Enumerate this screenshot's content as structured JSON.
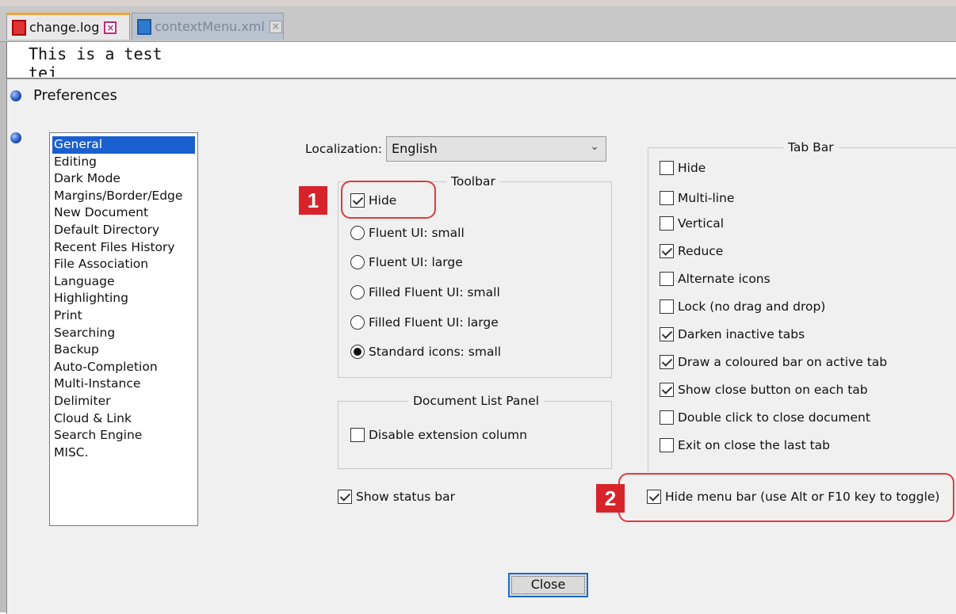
{
  "editor_tabs": [
    {
      "label": "change.log"
    },
    {
      "label": "contextMenu.xml"
    }
  ],
  "editor_lines": [
    "This is a test",
    "tej"
  ],
  "dialog": {
    "title": "Preferences",
    "close_label": "Close"
  },
  "categories": [
    "General",
    "Editing",
    "Dark Mode",
    "Margins/Border/Edge",
    "New Document",
    "Default Directory",
    "Recent Files History",
    "File Association",
    "Language",
    "Highlighting",
    "Print",
    "Searching",
    "Backup",
    "Auto-Completion",
    "Multi-Instance",
    "Delimiter",
    "Cloud & Link",
    "Search Engine",
    "MISC."
  ],
  "localization": {
    "label": "Localization:",
    "value": "English"
  },
  "toolbar": {
    "title": "Toolbar",
    "hide": {
      "label": "Hide",
      "checked": true
    },
    "options": [
      {
        "label": "Fluent UI: small",
        "selected": false
      },
      {
        "label": "Fluent UI: large",
        "selected": false
      },
      {
        "label": "Filled Fluent UI: small",
        "selected": false
      },
      {
        "label": "Filled Fluent UI: large",
        "selected": false
      },
      {
        "label": "Standard icons: small",
        "selected": true
      }
    ]
  },
  "doc_list": {
    "title": "Document List Panel",
    "disable_ext": {
      "label": "Disable extension column",
      "checked": false
    }
  },
  "status_bar": {
    "label": "Show status bar",
    "checked": true
  },
  "tab_bar": {
    "title": "Tab Bar",
    "options": [
      {
        "label": "Hide",
        "checked": false
      },
      {
        "label": "Multi-line",
        "checked": false
      },
      {
        "label": "Vertical",
        "checked": false
      },
      {
        "label": "Reduce",
        "checked": true
      },
      {
        "label": "Alternate icons",
        "checked": false
      },
      {
        "label": "Lock (no drag and drop)",
        "checked": false
      },
      {
        "label": "Darken inactive tabs",
        "checked": true
      },
      {
        "label": "Draw a coloured bar on active tab",
        "checked": true
      },
      {
        "label": "Show close button on each tab",
        "checked": true
      },
      {
        "label": "Double click to close document",
        "checked": false
      },
      {
        "label": "Exit on close the last tab",
        "checked": false
      }
    ]
  },
  "menu_bar": {
    "label": "Hide menu bar (use Alt or F10 key to toggle)",
    "checked": true
  },
  "badges": {
    "one": "1",
    "two": "2"
  },
  "colors": {
    "selection": "#1a5fd0",
    "callout": "#e03a3e",
    "badge": "#d8232a"
  }
}
